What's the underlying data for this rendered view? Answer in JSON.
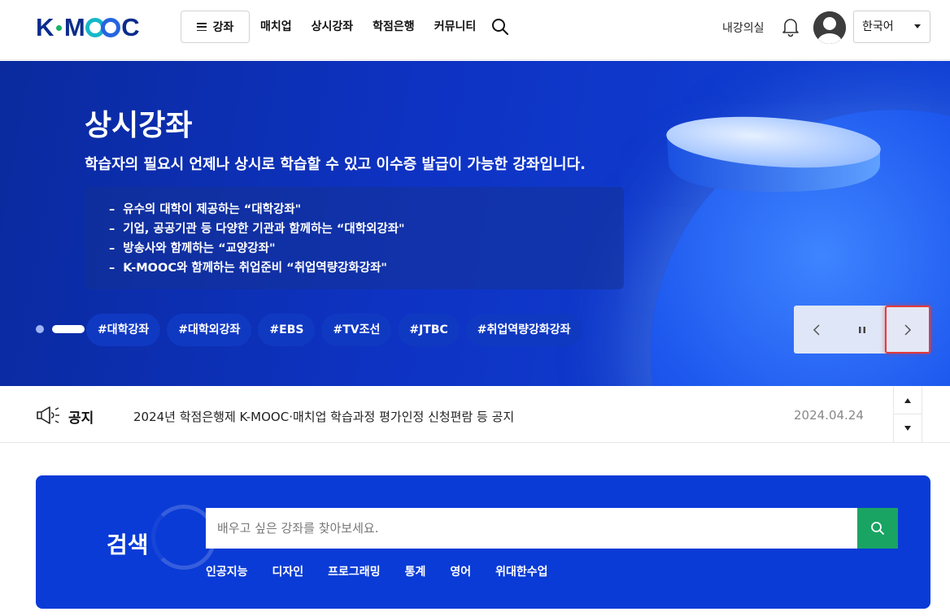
{
  "header": {
    "logo_text": {
      "k": "K",
      "rest": "M",
      "c": "C"
    },
    "menu_label": "강좌",
    "nav": [
      "매치업",
      "상시강좌",
      "학점은행",
      "커뮤니티"
    ],
    "my_room": "내강의실",
    "language": "한국어"
  },
  "hero": {
    "title": "상시강좌",
    "subtitle": "학습자의 필요시 언제나 상시로 학습할 수 있고 이수증 발급이 가능한 강좌입니다.",
    "bullets": [
      "유수의 대학이 제공하는 “대학강좌\"",
      "기업, 공공기관 등 다양한 기관과 함께하는 “대학외강좌\"",
      "방송사와 함께하는 “교양강좌\"",
      "K-MOOC와 함께하는 취업준비 “취업역량강화강좌\""
    ],
    "tags": [
      "#대학강좌",
      "#대학외강좌",
      "#EBS",
      "#TV조선",
      "#JTBC",
      "#취업역량강화강좌"
    ]
  },
  "notice": {
    "label": "공지",
    "text": "2024년 학점은행제 K-MOOC·매치업 학습과정 평가인정 신청편람 등 공지",
    "date": "2024.04.24"
  },
  "search": {
    "title": "검색",
    "placeholder": "배우고 싶은 강좌를 찾아보세요.",
    "keywords": [
      "인공지능",
      "디자인",
      "프로그래밍",
      "통계",
      "영어",
      "위대한수업"
    ]
  },
  "colors": {
    "brand_navy": "#0a2c8c",
    "hero_blue": "#0e33c4",
    "search_blue": "#0a3bd6",
    "search_button": "#19a463",
    "highlight": "#e23b3b"
  }
}
